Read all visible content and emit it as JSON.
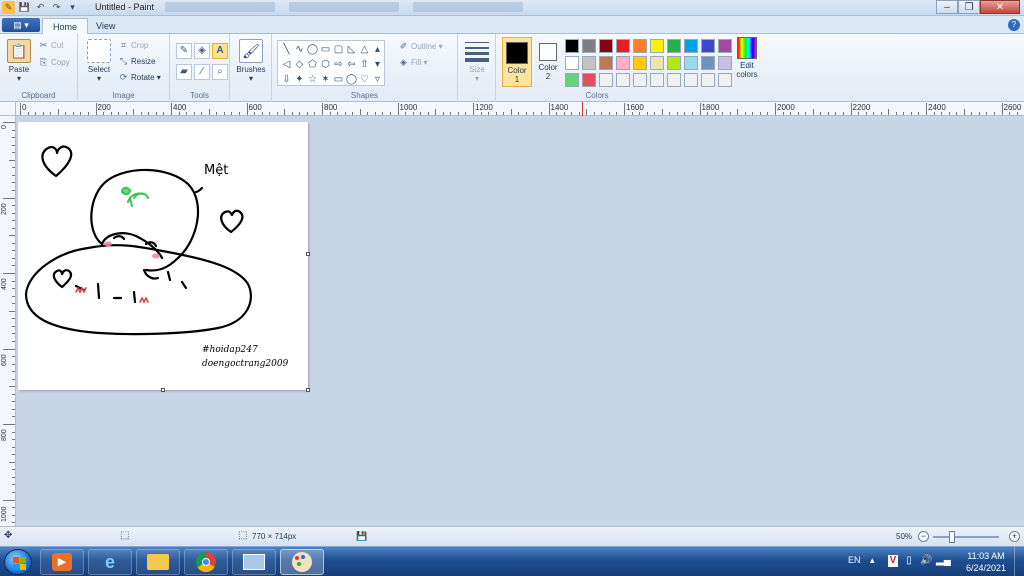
{
  "window": {
    "title": "Untitled - Paint",
    "min": "–",
    "max": "❐",
    "close": "✕"
  },
  "quick_access": {
    "save_glyph": "💾",
    "undo_glyph": "↶",
    "redo_glyph": "↷",
    "more_glyph": "▾"
  },
  "ribbon_tabs": {
    "menu_label": "▤ ▾",
    "home": "Home",
    "view": "View",
    "help": "?"
  },
  "clipboard": {
    "label": "Clipboard",
    "paste": "Paste",
    "cut": "Cut",
    "copy": "Copy"
  },
  "image": {
    "label": "Image",
    "select": "Select",
    "crop": "Crop",
    "resize": "Resize",
    "rotate": "Rotate ▾"
  },
  "tools": {
    "label": "Tools"
  },
  "brushes": {
    "label": "Brushes"
  },
  "shapes": {
    "label": "Shapes",
    "outline": "Outline ▾",
    "fill": "Fill ▾",
    "glyphs": [
      "╲",
      "∿",
      "◯",
      "▭",
      "▢",
      "◺",
      "△",
      "▴",
      "◁",
      "◇",
      "⬠",
      "⬡",
      "⇨",
      "⇦",
      "⇧",
      "▾",
      "⇩",
      "✦",
      "☆",
      "✶",
      "▭",
      "◯",
      "♡",
      "▿"
    ]
  },
  "size": {
    "label": "Size"
  },
  "colors": {
    "label": "Colors",
    "color1_label": "Color\n1",
    "color1_l1": "Color",
    "color1_l2": "1",
    "color2_l1": "Color",
    "color2_l2": "2",
    "color1": "#000000",
    "color2": "#ffffff",
    "edit_l1": "Edit",
    "edit_l2": "colors",
    "palette": [
      "#000000",
      "#7f7f7f",
      "#880015",
      "#ed1c24",
      "#ff7f27",
      "#fff200",
      "#22b14c",
      "#00a2e8",
      "#3f48cc",
      "#a349a4",
      "#ffffff",
      "#c3c3c3",
      "#b97a57",
      "#ffaec9",
      "#ffc90e",
      "#efe4b0",
      "#b5e61d",
      "#99d9ea",
      "#7092be",
      "#c8bfe7",
      "#66d37a",
      "#e84a5f",
      "#f0f0f0",
      "#f0f0f0",
      "#f0f0f0",
      "#f0f0f0",
      "#f0f0f0",
      "#f0f0f0",
      "#f0f0f0",
      "#f0f0f0"
    ]
  },
  "ruler": {
    "labels": [
      "0",
      "200",
      "400",
      "600",
      "800",
      "1000",
      "1200",
      "1400",
      "1600",
      "1800",
      "2000",
      "2200",
      "2400",
      "2600"
    ],
    "vlabels": [
      "0",
      "200",
      "400",
      "600",
      "800",
      "1000"
    ]
  },
  "drawing": {
    "word": "Mệt",
    "tag1": "#hoidap247",
    "tag2": "doengoctrang2009"
  },
  "statusbar": {
    "move_glyph": "✥",
    "selection_glyph": "⬚",
    "dimensions": "770 × 714px",
    "disk_glyph": "💾",
    "zoom": "50%",
    "zoom_out": "−",
    "zoom_in": "+"
  },
  "taskbar": {
    "lang": "EN",
    "tray_arrow": "▴",
    "time": "11:03 AM",
    "date": "6/24/2021"
  }
}
